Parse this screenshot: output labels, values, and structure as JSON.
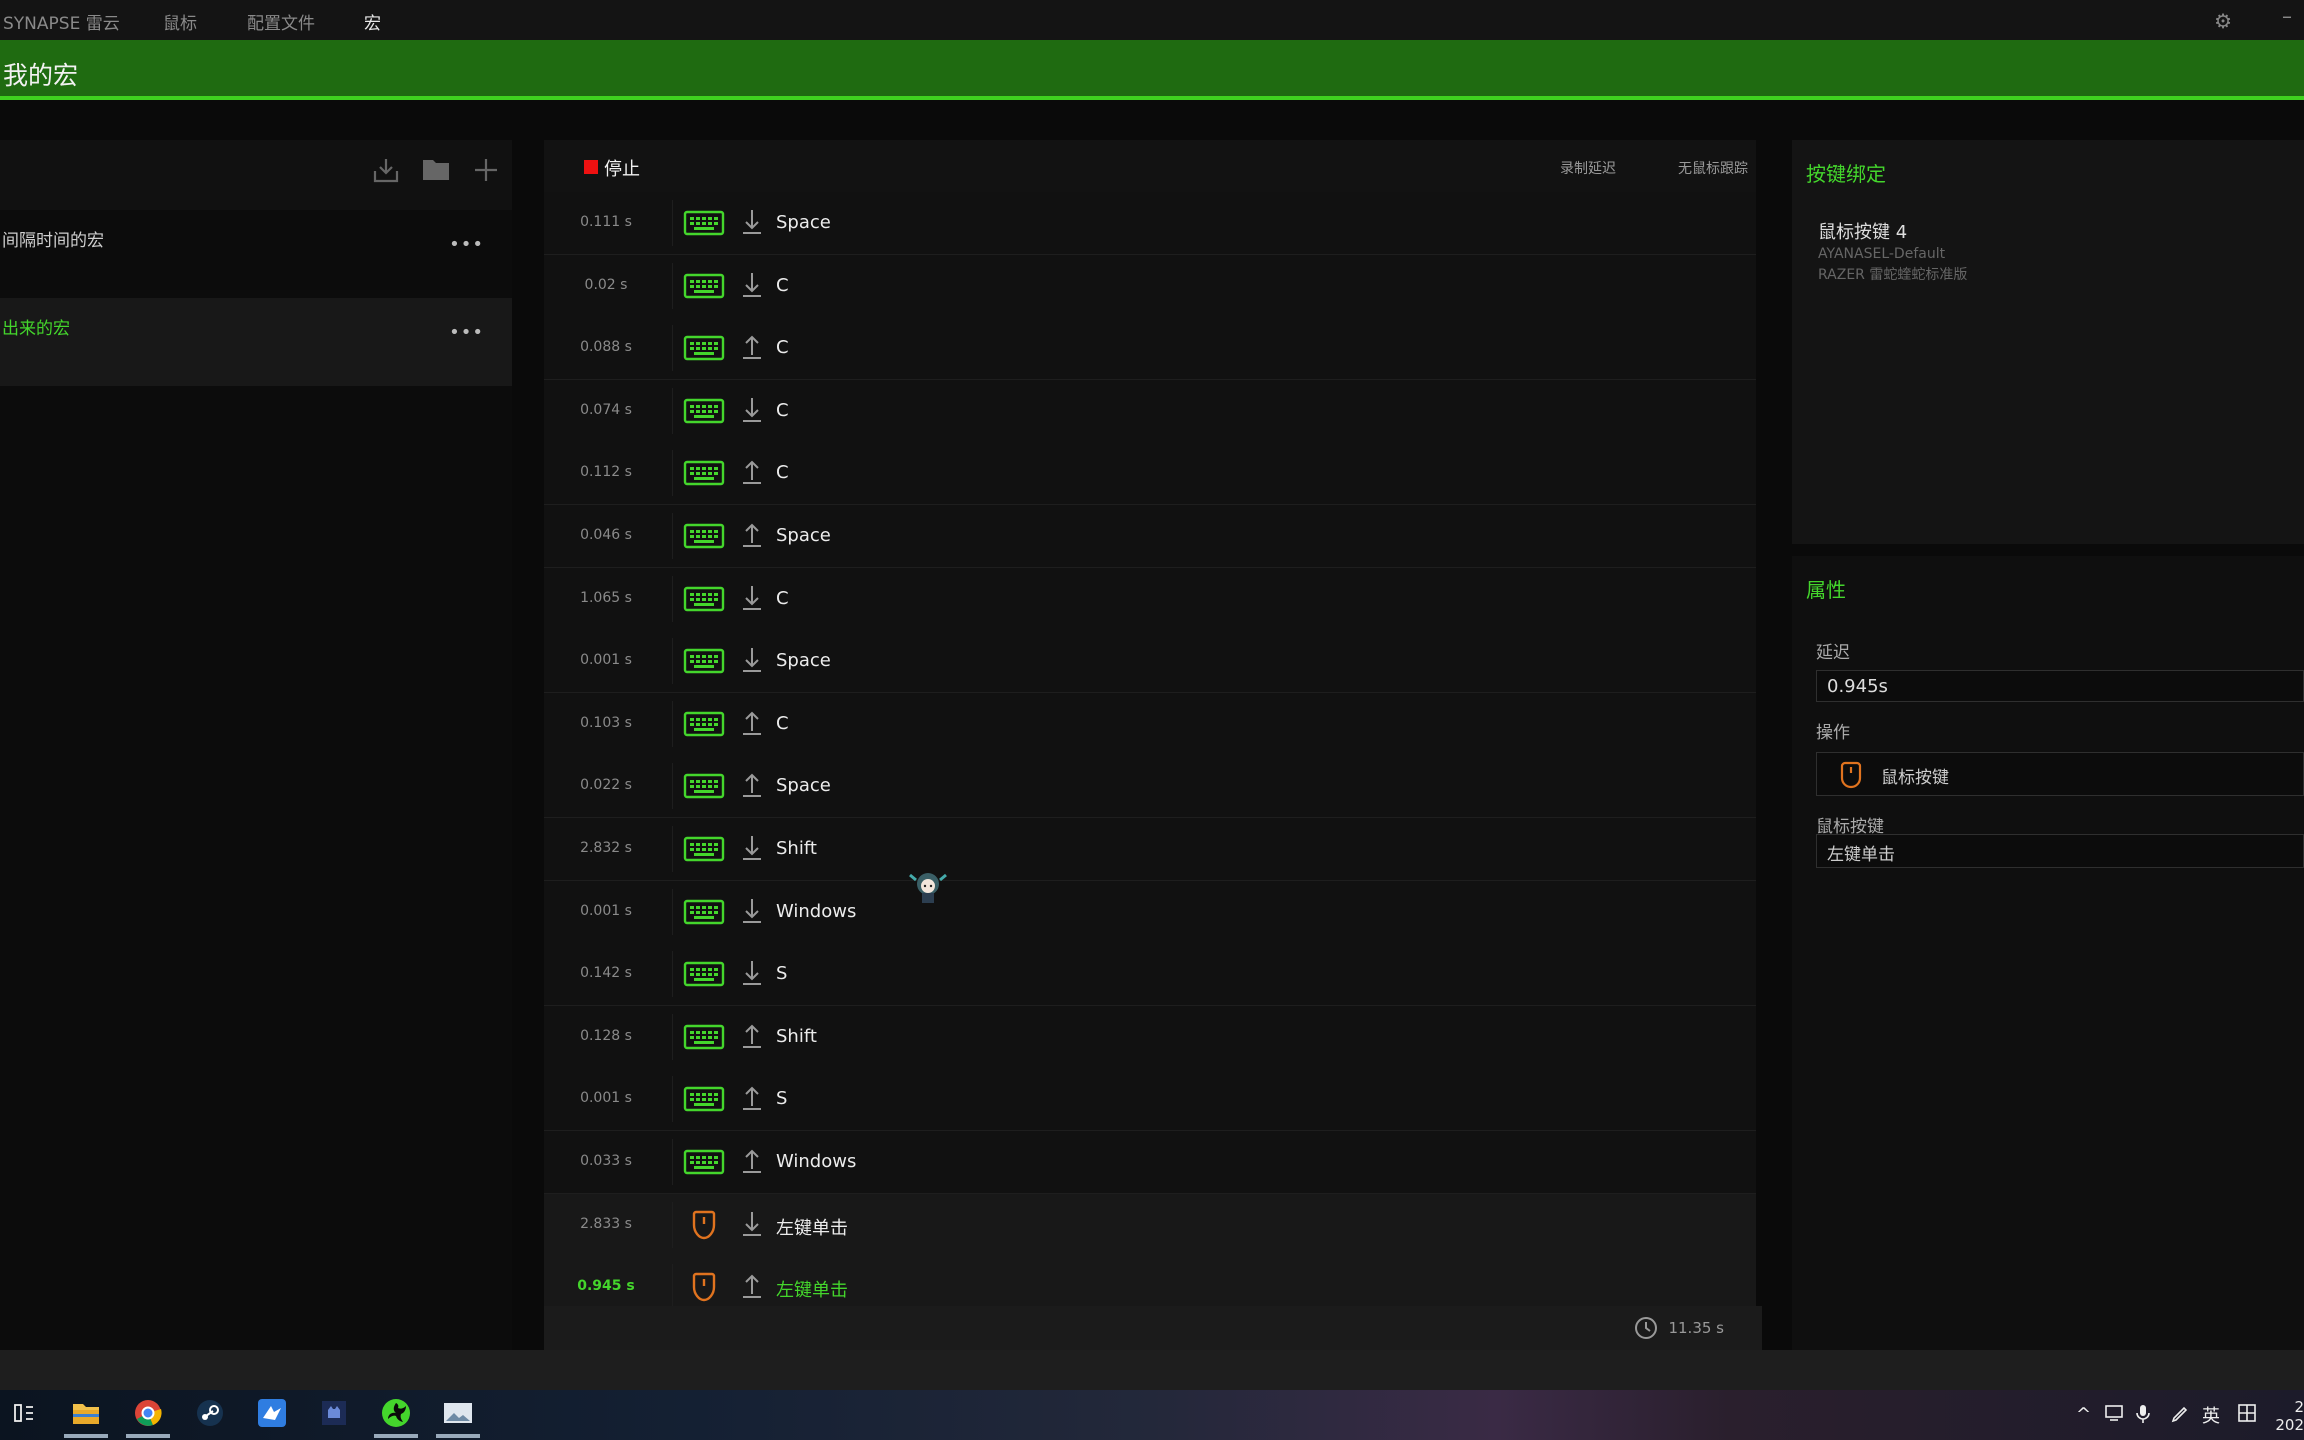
{
  "top_menu": {
    "app_name": "SYNAPSE 雷云",
    "items": [
      "鼠标",
      "配置文件",
      "宏"
    ],
    "active": "宏"
  },
  "header": {
    "title": "我的宏"
  },
  "left_panel": {
    "macros": [
      {
        "name": "间隔时间的宏",
        "more": "•••"
      },
      {
        "name": "出来的宏",
        "more": "•••",
        "selected": true
      }
    ]
  },
  "recorder": {
    "stop_label": "停止",
    "record_delay_label": "录制延迟",
    "no_mouse_tracking_label": "无鼠标跟踪",
    "total_time": "11.35 s",
    "events": [
      {
        "time": "0.111 s",
        "device": "keyboard",
        "direction": "down",
        "key": "Space"
      },
      {
        "time": "0.02 s",
        "device": "keyboard",
        "direction": "down",
        "key": "C"
      },
      {
        "time": "0.088 s",
        "device": "keyboard",
        "direction": "up",
        "key": "C"
      },
      {
        "time": "0.074 s",
        "device": "keyboard",
        "direction": "down",
        "key": "C"
      },
      {
        "time": "0.112 s",
        "device": "keyboard",
        "direction": "up",
        "key": "C"
      },
      {
        "time": "0.046 s",
        "device": "keyboard",
        "direction": "up",
        "key": "Space"
      },
      {
        "time": "1.065 s",
        "device": "keyboard",
        "direction": "down",
        "key": "C"
      },
      {
        "time": "0.001 s",
        "device": "keyboard",
        "direction": "down",
        "key": "Space"
      },
      {
        "time": "0.103 s",
        "device": "keyboard",
        "direction": "up",
        "key": "C"
      },
      {
        "time": "0.022 s",
        "device": "keyboard",
        "direction": "up",
        "key": "Space"
      },
      {
        "time": "2.832 s",
        "device": "keyboard",
        "direction": "down",
        "key": "Shift"
      },
      {
        "time": "0.001 s",
        "device": "keyboard",
        "direction": "down",
        "key": "Windows"
      },
      {
        "time": "0.142 s",
        "device": "keyboard",
        "direction": "down",
        "key": "S"
      },
      {
        "time": "0.128 s",
        "device": "keyboard",
        "direction": "up",
        "key": "Shift"
      },
      {
        "time": "0.001 s",
        "device": "keyboard",
        "direction": "up",
        "key": "S"
      },
      {
        "time": "0.033 s",
        "device": "keyboard",
        "direction": "up",
        "key": "Windows"
      },
      {
        "time": "2.833 s",
        "device": "mouse",
        "direction": "down",
        "key": "左键单击"
      },
      {
        "time": "0.945 s",
        "device": "mouse",
        "direction": "up",
        "key": "左键单击",
        "selected": true
      }
    ]
  },
  "key_binding": {
    "title": "按键绑定",
    "button": "鼠标按键 4",
    "profile": "AYANASEL-Default",
    "device": "RAZER 雷蛇蝰蛇标准版"
  },
  "properties": {
    "title": "属性",
    "delay_label": "延迟",
    "delay_value": "0.945s",
    "action_label": "操作",
    "action_value": "鼠标按键",
    "mouse_button_label": "鼠标按键",
    "mouse_button_value": "左键单击"
  },
  "taskbar": {
    "ime_lang": "英",
    "clock": [
      "2",
      "202"
    ]
  },
  "colors": {
    "accent": "#44d62c",
    "header_green": "#1f6b11",
    "mouse_orange": "#e0731f",
    "stop_red": "#ee1111"
  }
}
